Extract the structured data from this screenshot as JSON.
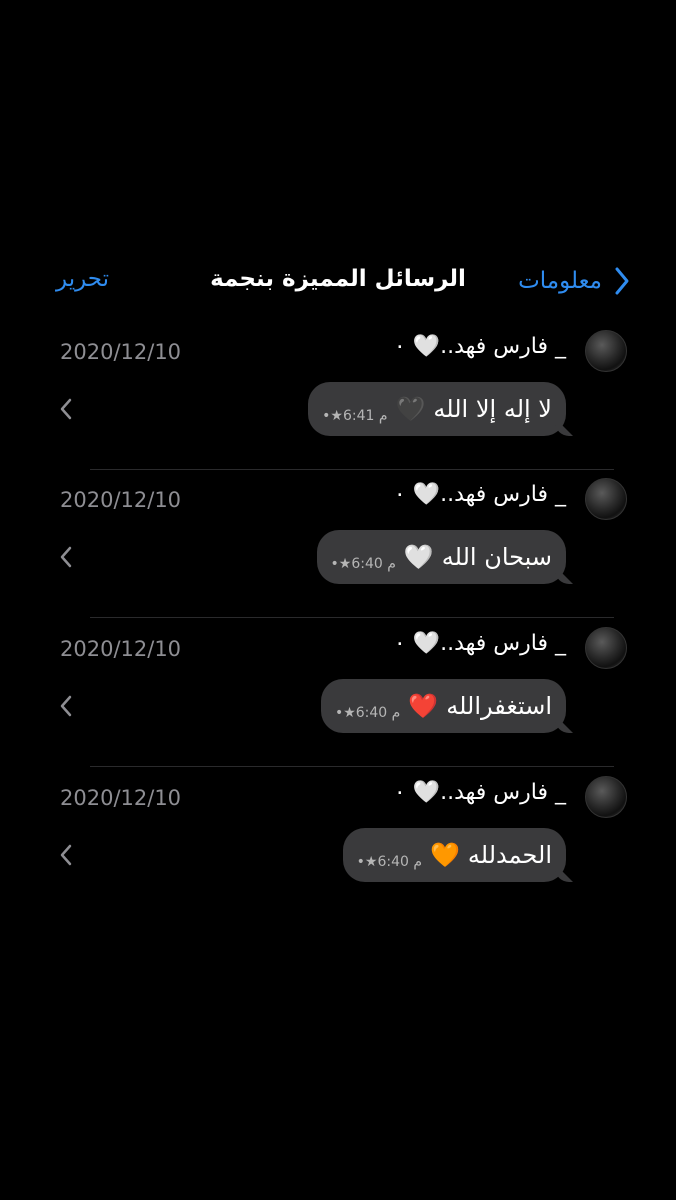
{
  "nav": {
    "back_label": "معلومات",
    "title": "الرسائل المميزة بنجمة",
    "edit_label": "تحرير"
  },
  "messages": [
    {
      "sender": "فارس فهد..🤍 ٠ _",
      "date": "2020/12/10",
      "text": "لا إله إلا الله",
      "emoji": "🖤",
      "meta": "•★6:41 م"
    },
    {
      "sender": "فارس فهد..🤍 ٠ _",
      "date": "2020/12/10",
      "text": "سبحان الله",
      "emoji": "🤍",
      "meta": "•★6:40 م"
    },
    {
      "sender": "فارس فهد..🤍 ٠ _",
      "date": "2020/12/10",
      "text": "استغفرالله",
      "emoji": "❤️",
      "meta": "•★6:40 م"
    },
    {
      "sender": "فارس فهد..🤍 ٠ _",
      "date": "2020/12/10",
      "text": "الحمدلله",
      "emoji": "🧡",
      "meta": "•★6:40 م"
    }
  ],
  "colors": {
    "background": "#000000",
    "accent": "#2f8cf0",
    "bubble": "#3a3a3c",
    "date": "#8e8e93"
  },
  "icons": {
    "back": "chevron-right-icon",
    "row": "chevron-left-icon"
  }
}
